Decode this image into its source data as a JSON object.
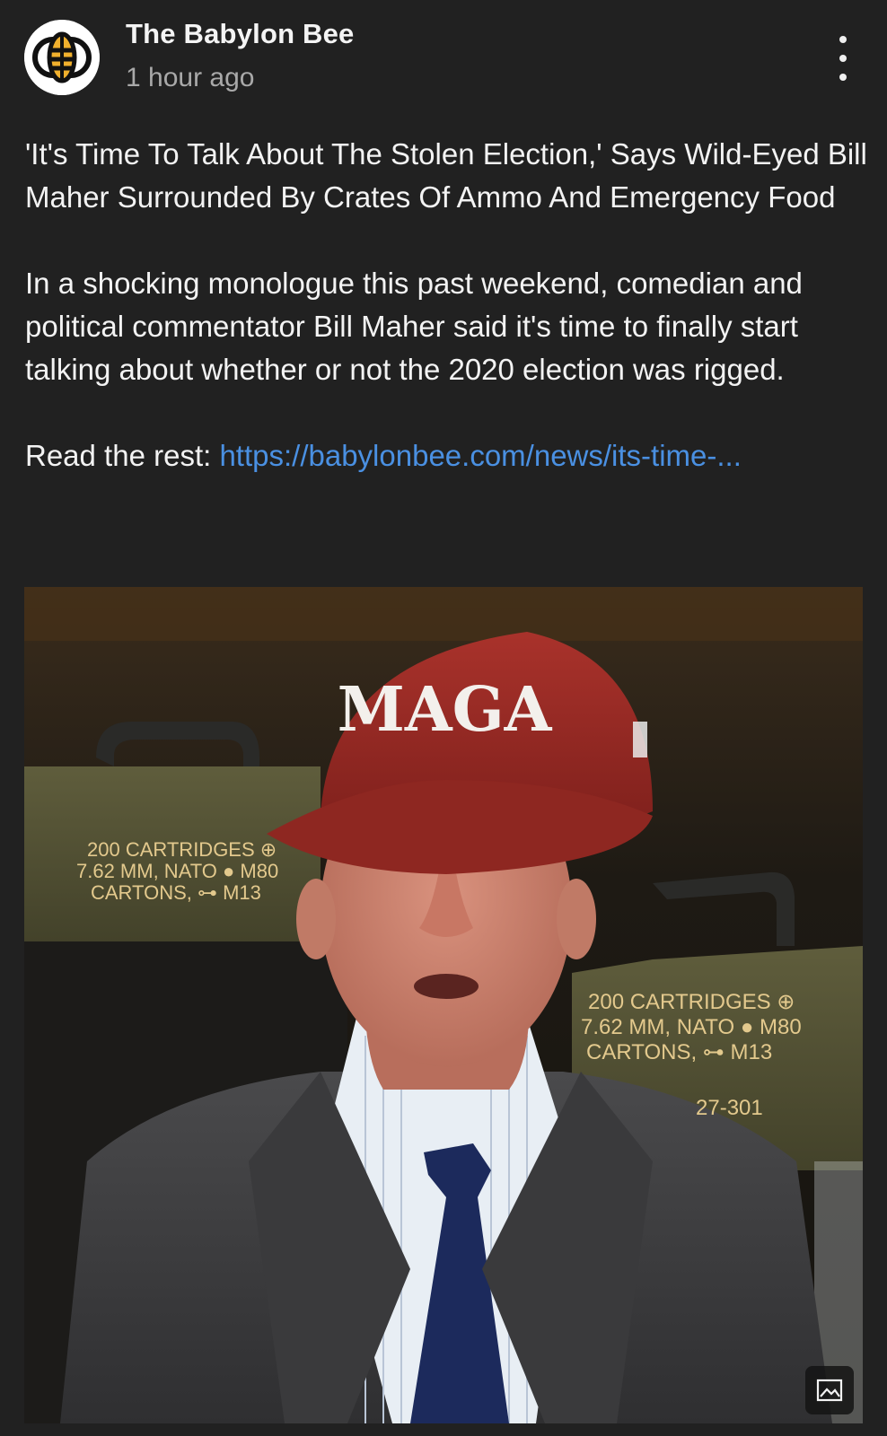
{
  "author": {
    "name": "The Babylon Bee",
    "timestamp": "1 hour ago"
  },
  "post": {
    "headline": "'It's Time To Talk About The Stolen Election,' Says Wild-Eyed Bill Maher Surrounded By Crates Of Ammo And Emergency Food",
    "body": "In a shocking monologue this past weekend, comedian and political commentator Bill Maher said it's time to finally start talking about whether or not the 2020 election was rigged.",
    "read_more_label": "Read the rest: ",
    "link_text": "https://babylonbee.com/news/its-time-..."
  },
  "image": {
    "hat_text": "MAGA",
    "crate_left": [
      "200 CARTRIDGES ⊕",
      "7.62 MM, NATO ● M80",
      "CARTONS, ⊶ M13"
    ],
    "crate_right": [
      "200 CARTRIDGES ⊕",
      "7.62 MM, NATO ● M80",
      "CARTONS, ⊶ M13",
      "27-301"
    ]
  },
  "icons": {
    "more": "more-vertical-icon",
    "image": "image-icon",
    "avatar": "babylon-bee-logo"
  },
  "colors": {
    "background": "#212121",
    "link": "#4a90e2",
    "text": "#f3f3f3",
    "muted": "#a9a9a9"
  }
}
